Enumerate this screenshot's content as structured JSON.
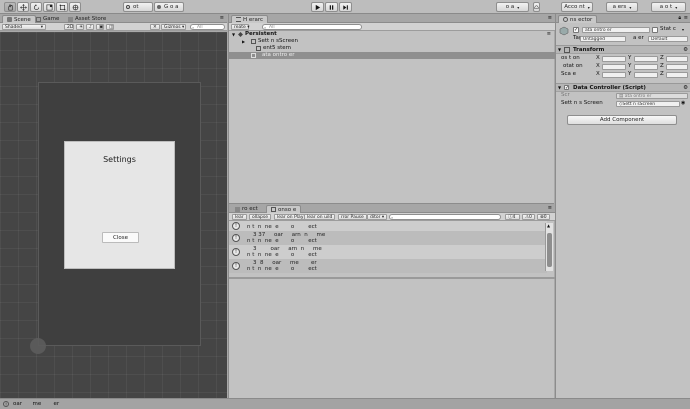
{
  "toolbar": {
    "tools": [
      "hand-tool",
      "move-tool",
      "rotate-tool",
      "scale-tool",
      "rect-tool",
      "transform-tool"
    ],
    "pivot_label": "ot",
    "global_label": "G o a",
    "collab_label": "o a",
    "account_label": "Acco nt",
    "layers_label": "a ers",
    "layout_label": "a o t"
  },
  "scene": {
    "tabs": [
      {
        "label": "Scene",
        "icon": "scene-icon"
      },
      {
        "label": "Game",
        "icon": "game-icon"
      },
      {
        "label": "Asset Store",
        "icon": "store-icon"
      }
    ],
    "shading_mode": "Shaded",
    "mode_2d": "2D",
    "gizmos_label": "Gizmos",
    "search_placeholder": "All",
    "panel_title": "Settings",
    "close_label": "Close"
  },
  "hierarchy": {
    "tab_label": "H erarc",
    "create_label": "reate",
    "search_placeholder": "All",
    "scene_name": "Persistent",
    "items": [
      {
        "label": "Sett n  sScreen",
        "depth": 1,
        "selected": false,
        "has_children": true
      },
      {
        "label": "ent5  stem",
        "depth": 2,
        "selected": false,
        "has_children": false
      },
      {
        "label": "ata   ontro  er",
        "depth": 1,
        "selected": true,
        "has_children": false
      }
    ]
  },
  "console": {
    "tabs": [
      {
        "label": "ro ect",
        "icon": "project-icon"
      },
      {
        "label": "onso e",
        "icon": "console-icon"
      }
    ],
    "buttons": [
      "lear",
      "ollapse",
      "lear on Play",
      "lear on  uild",
      "rror Pause",
      "ditor"
    ],
    "search_placeholder": "",
    "counts": {
      "info": "4",
      "warning": "0",
      "error": "0"
    },
    "entries": [
      {
        "line1": "n t  n  ne  e       o        ect",
        "line2": ""
      },
      {
        "line1": "3 37     oar     arn  n     me",
        "line2": "n t  n  ne  e       o        ect"
      },
      {
        "line1": "3        oar     arn  n     me",
        "line2": "n t  n  ne  e       o        ect"
      },
      {
        "line1": "3  8     oar     me       er",
        "line2": "n t  n  ne  e       o        ect"
      }
    ]
  },
  "inspector": {
    "tab_label": "ns  ector",
    "object_name": "ata   ontro  er",
    "static_label": "Stat c",
    "tag_label": "Untagged",
    "layer_caption": "a er",
    "layer_value": "Default",
    "transform": {
      "title": "Transform",
      "rows": [
        {
          "label": "os t on",
          "axes": [
            "X",
            "Y",
            "Z"
          ]
        },
        {
          "label": "otat on",
          "axes": [
            "X",
            "Y",
            "Z"
          ]
        },
        {
          "label": "Sca e",
          "axes": [
            "X",
            "Y",
            "Z"
          ]
        }
      ]
    },
    "script_component": {
      "title": "Data Controller (Script)",
      "script_caption": "Scr",
      "script_value": "ata   ontro  er",
      "field_label": "Sett n  s Screen",
      "field_value": "Sett n  sScreen"
    },
    "add_component_label": "Add Component"
  },
  "statusbar": {
    "message": "oar      me       er"
  }
}
